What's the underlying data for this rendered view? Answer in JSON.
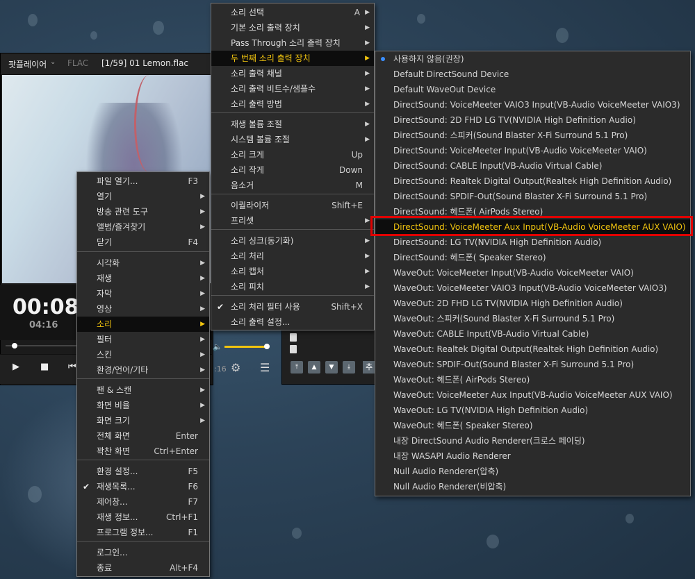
{
  "player": {
    "brand": "팟플레이어",
    "codec": "FLAC",
    "track": "[1/59]  01  Lemon.flac",
    "current_time": "00:08",
    "total_time": "04:16",
    "time_fragment": "16",
    "seek_fraction": 0.03,
    "volume_fraction": 0.95
  },
  "main_menu": {
    "items": [
      {
        "label": "파일 열기...",
        "shortcut": "F3"
      },
      {
        "label": "열기",
        "submenu": true
      },
      {
        "label": "방송 관련 도구",
        "submenu": true
      },
      {
        "label": "앨범/즐겨찾기",
        "submenu": true
      },
      {
        "label": "닫기",
        "shortcut": "F4"
      },
      {
        "label": "시각화",
        "submenu": true
      },
      {
        "label": "재생",
        "submenu": true
      },
      {
        "label": "자막",
        "submenu": true
      },
      {
        "label": "영상",
        "submenu": true
      },
      {
        "label": "소리",
        "submenu": true,
        "active": true
      },
      {
        "label": "필터",
        "submenu": true
      },
      {
        "label": "스킨",
        "submenu": true
      },
      {
        "label": "환경/언어/기타",
        "submenu": true
      },
      {
        "label": "팬 & 스캔",
        "submenu": true
      },
      {
        "label": "화면 비율",
        "submenu": true
      },
      {
        "label": "화면 크기",
        "submenu": true
      },
      {
        "label": "전체 화면",
        "shortcut": "Enter"
      },
      {
        "label": "꽉찬 화면",
        "shortcut": "Ctrl+Enter"
      },
      {
        "label": "환경 설정...",
        "shortcut": "F5"
      },
      {
        "label": "재생목록...",
        "shortcut": "F6",
        "checked": true
      },
      {
        "label": "제어창...",
        "shortcut": "F7"
      },
      {
        "label": "재생 정보...",
        "shortcut": "Ctrl+F1"
      },
      {
        "label": "프로그램 정보...",
        "shortcut": "F1"
      },
      {
        "label": "로그인..."
      },
      {
        "label": "종료",
        "shortcut": "Alt+F4"
      }
    ]
  },
  "sound_menu": {
    "items": [
      {
        "label": "소리 선택",
        "shortcut": "A",
        "submenu": true
      },
      {
        "label": "기본 소리 출력 장치",
        "submenu": true
      },
      {
        "label": "Pass Through 소리 출력 장치",
        "submenu": true
      },
      {
        "label": "두 번째 소리 출력 장치",
        "submenu": true,
        "active": true
      },
      {
        "label": "소리 출력 채널",
        "submenu": true
      },
      {
        "label": "소리 출력 비트수/샘플수",
        "submenu": true
      },
      {
        "label": "소리 출력 방법",
        "submenu": true
      },
      {
        "label": "재생 볼륨 조절",
        "submenu": true
      },
      {
        "label": "시스템 볼륨 조절",
        "submenu": true
      },
      {
        "label": "소리 크게",
        "shortcut": "Up"
      },
      {
        "label": "소리 작게",
        "shortcut": "Down"
      },
      {
        "label": "음소거",
        "shortcut": "M"
      },
      {
        "label": "이퀄라이저",
        "shortcut": "Shift+E"
      },
      {
        "label": "프리셋",
        "submenu": true
      },
      {
        "label": "소리 싱크(동기화)",
        "submenu": true
      },
      {
        "label": "소리 처리",
        "submenu": true
      },
      {
        "label": "소리 캡처",
        "submenu": true
      },
      {
        "label": "소리 피치",
        "submenu": true
      },
      {
        "label": "소리 처리 필터 사용",
        "shortcut": "Shift+X",
        "checked": true
      },
      {
        "label": "소리 출력 설정..."
      }
    ]
  },
  "device_menu": {
    "items": [
      {
        "label": "사용하지 않음(권장)",
        "selected": true
      },
      {
        "label": "Default DirectSound Device"
      },
      {
        "label": "Default WaveOut Device"
      },
      {
        "label": "DirectSound: VoiceMeeter VAIO3 Input(VB-Audio VoiceMeeter VAIO3)"
      },
      {
        "label": "DirectSound: 2D FHD LG TV(NVIDIA High Definition Audio)"
      },
      {
        "label": "DirectSound: 스피커(Sound Blaster X-Fi Surround 5.1 Pro)"
      },
      {
        "label": "DirectSound: VoiceMeeter Input(VB-Audio VoiceMeeter VAIO)"
      },
      {
        "label": "DirectSound: CABLE Input(VB-Audio Virtual Cable)"
      },
      {
        "label": "DirectSound: Realtek Digital Output(Realtek High Definition Audio)"
      },
      {
        "label": "DirectSound: SPDIF-Out(Sound Blaster X-Fi Surround 5.1 Pro)"
      },
      {
        "label": "DirectSound: 헤드폰(           AirPods Stereo)"
      },
      {
        "label": "DirectSound: VoiceMeeter Aux Input(VB-Audio VoiceMeeter AUX VAIO)",
        "active": true
      },
      {
        "label": "DirectSound: LG TV(NVIDIA High Definition Audio)"
      },
      {
        "label": "DirectSound: 헤드폰(          Speaker Stereo)"
      },
      {
        "label": "WaveOut: VoiceMeeter Input(VB-Audio VoiceMeeter VAIO)"
      },
      {
        "label": "WaveOut: VoiceMeeter VAIO3 Input(VB-Audio VoiceMeeter VAIO3)"
      },
      {
        "label": "WaveOut: 2D FHD LG TV(NVIDIA High Definition Audio)"
      },
      {
        "label": "WaveOut: 스피커(Sound Blaster X-Fi Surround 5.1 Pro)"
      },
      {
        "label": "WaveOut: CABLE Input(VB-Audio Virtual Cable)"
      },
      {
        "label": "WaveOut: Realtek Digital Output(Realtek High Definition Audio)"
      },
      {
        "label": "WaveOut: SPDIF-Out(Sound Blaster X-Fi Surround 5.1 Pro)"
      },
      {
        "label": "WaveOut: 헤드폰(           AirPods Stereo)"
      },
      {
        "label": "WaveOut: VoiceMeeter Aux Input(VB-Audio VoiceMeeter AUX VAIO)"
      },
      {
        "label": "WaveOut: LG TV(NVIDIA High Definition Audio)"
      },
      {
        "label": "WaveOut: 헤드폰(          Speaker Stereo)"
      },
      {
        "label": "내장 DirectSound Audio Renderer(크로스 페이딩)"
      },
      {
        "label": "내장 WASAPI Audio Renderer"
      },
      {
        "label": "Null Audio Renderer(압축)"
      },
      {
        "label": "Null Audio Renderer(비압축)"
      }
    ]
  },
  "colors": {
    "highlight_text": "#f1c40f",
    "selection_outline": "#e00000",
    "menu_bg": "#2b2b2b"
  },
  "playlist_add_label": "추"
}
